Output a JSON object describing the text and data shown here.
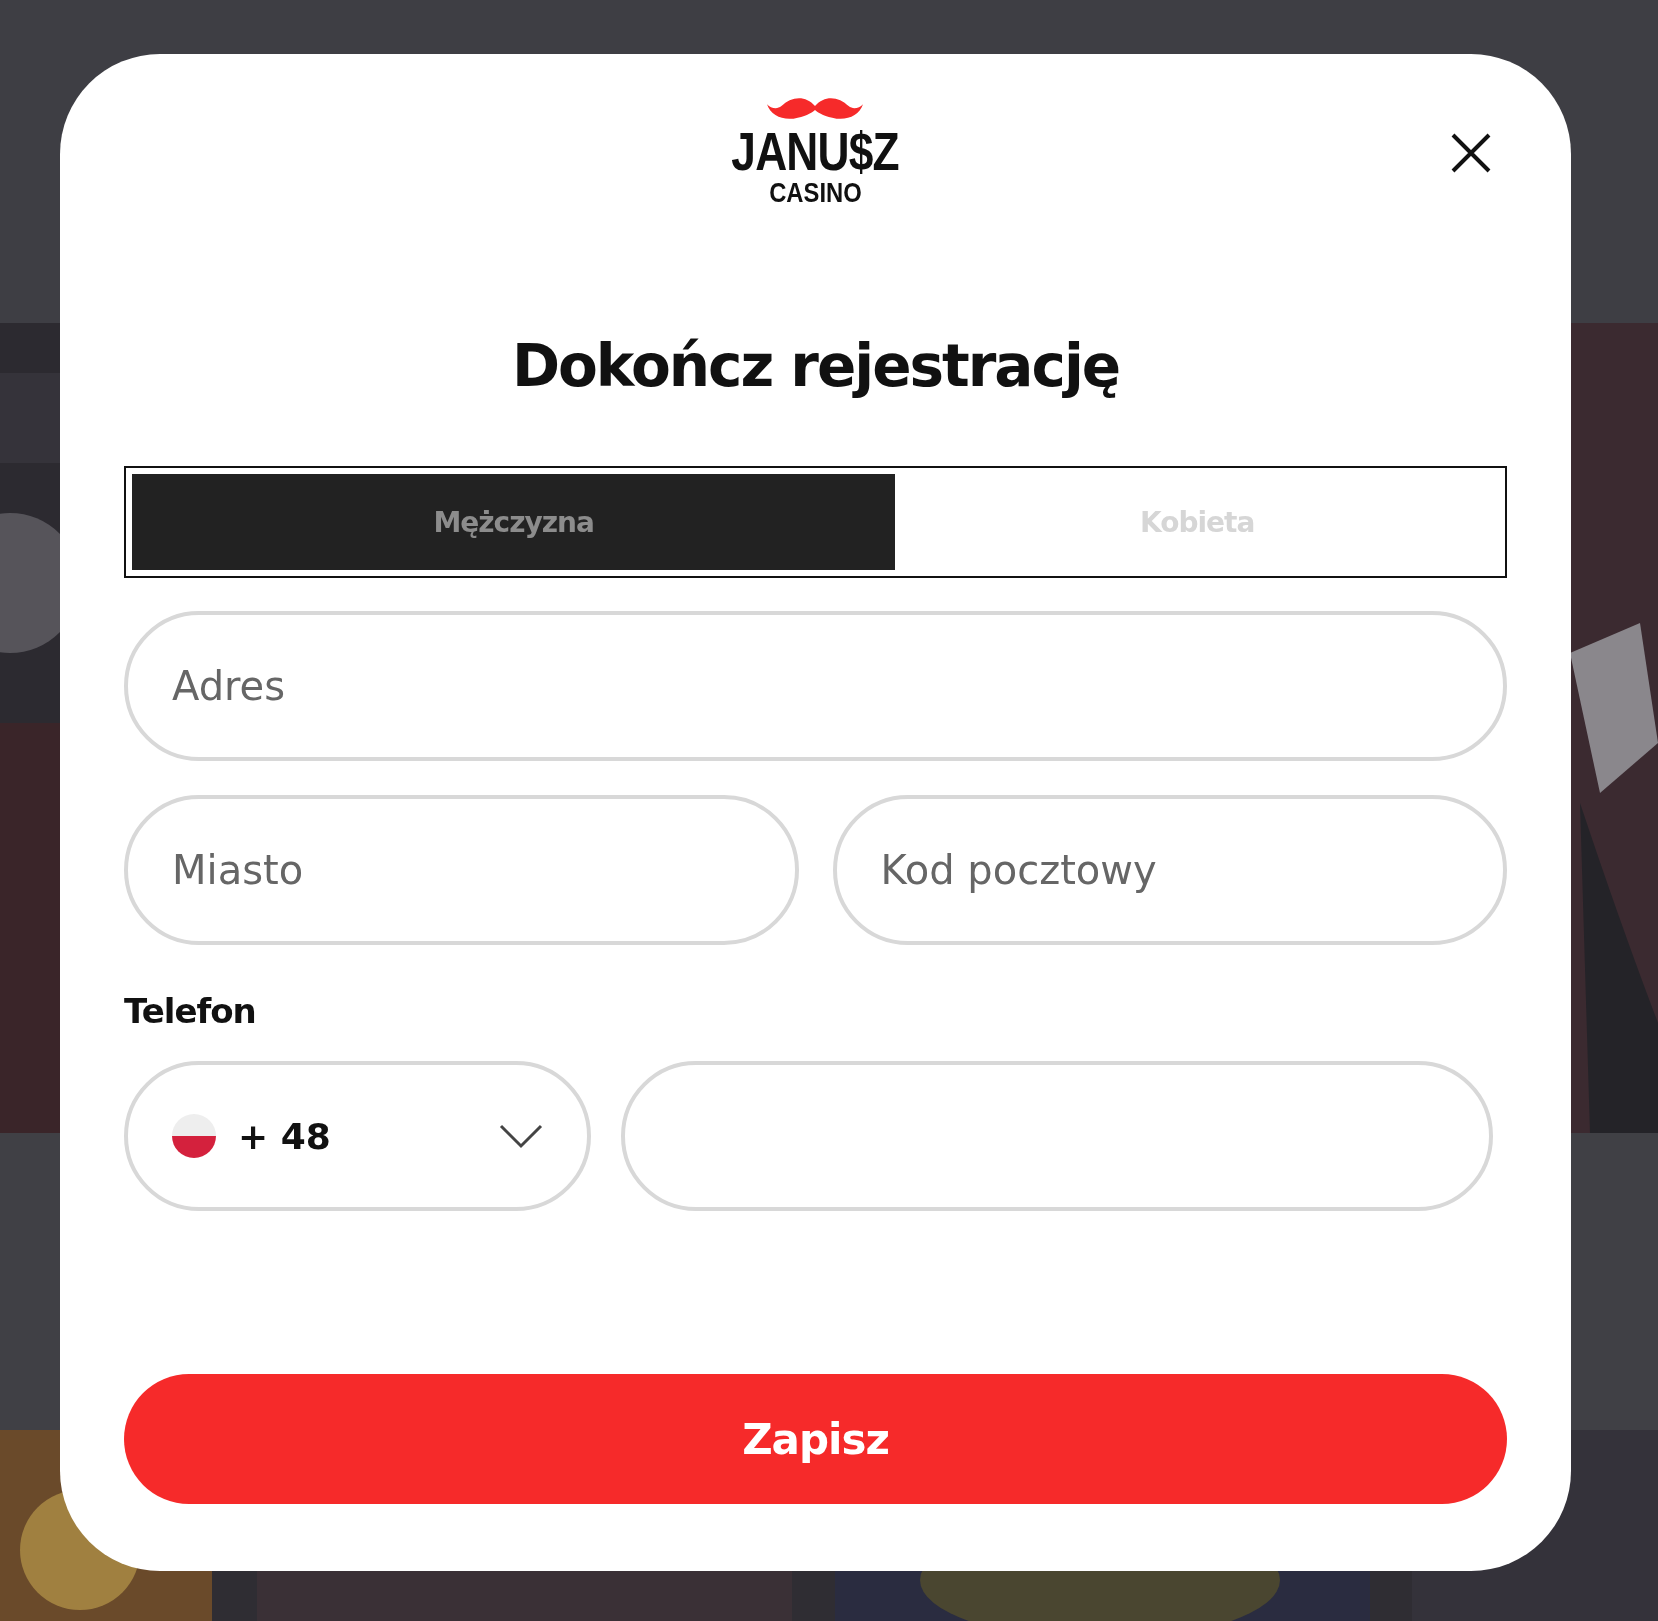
{
  "logo": {
    "name": "JANU$Z",
    "subtitle": "CASINO"
  },
  "dialog": {
    "title": "Dokończ rejestrację"
  },
  "gender_tabs": [
    {
      "label": "Mężczyzna",
      "selected": true
    },
    {
      "label": "Kobieta",
      "selected": false
    }
  ],
  "fields": [
    {
      "placeholder": "Adres"
    },
    {
      "placeholder": "Miasto"
    },
    {
      "placeholder": "Kod pocztowy"
    }
  ],
  "phone": {
    "label": "Telefon",
    "country_code": "+ 48"
  },
  "submit_button": "Zapisz"
}
